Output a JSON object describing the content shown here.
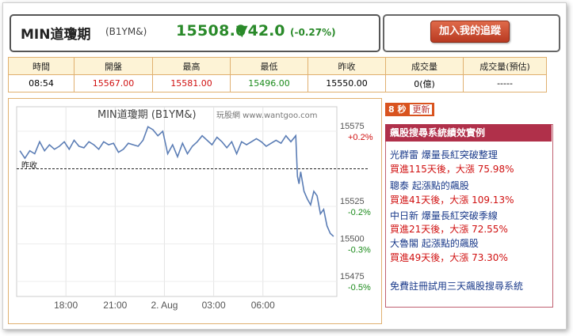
{
  "header": {
    "ticker": "MIN道瓊期",
    "code": "(B1YM&)",
    "price": "15508.0",
    "change_arrow": "▼",
    "change": "42.0",
    "change_pct": "(-0.27%)"
  },
  "track_button": "加入我的追蹤",
  "quote_table": {
    "headers": [
      "時間",
      "開盤",
      "最高",
      "最低",
      "昨收",
      "成交量",
      "成交量(預估)"
    ],
    "values": [
      "08:54",
      "15567.00",
      "15581.00",
      "15496.00",
      "15550.00",
      "0(億)",
      "-----"
    ]
  },
  "chart": {
    "title": "MIN道瓊期 (B1YM&)",
    "source": "玩股網 www.wantgoo.com",
    "prev_close_label": "昨收",
    "price_labels": [
      "15575",
      "15525",
      "15500",
      "15475"
    ],
    "pct_labels": [
      "+0.2%",
      "-0.2%",
      "-0.3%",
      "-0.5%"
    ],
    "x_labels": [
      "18:00",
      "21:00",
      "2. Aug",
      "03:00",
      "06:00"
    ]
  },
  "chart_data": {
    "type": "line",
    "title": "MIN道瓊期 (B1YM&)",
    "y_ticks": [
      15575,
      15525,
      15500,
      15475
    ],
    "y_pct_ticks": [
      "+0.2%",
      "-0.2%",
      "-0.3%",
      "-0.5%"
    ],
    "x_ticks": [
      "18:00",
      "21:00",
      "2. Aug",
      "03:00",
      "06:00"
    ],
    "prev_close": 15550,
    "ylim": [
      15465,
      15585
    ],
    "series": [
      {
        "x_hours": [
          15.2,
          15.5,
          15.8,
          16.1,
          16.4,
          16.7,
          17.0,
          17.3,
          17.6,
          17.9,
          18.2,
          18.5,
          18.8,
          19.1,
          19.4,
          19.7,
          20.0,
          20.3,
          20.6,
          20.9,
          21.2,
          21.5,
          21.8,
          22.1,
          22.4,
          22.7,
          23.0,
          23.3,
          23.6,
          23.9,
          24.2,
          24.5,
          24.8,
          25.1,
          25.4,
          25.7,
          26.0,
          26.3,
          26.6,
          26.9,
          27.2,
          27.5,
          27.8,
          28.1,
          28.4,
          28.7,
          29.0,
          29.3,
          29.6,
          29.9,
          30.2,
          30.5,
          30.8,
          31.1,
          31.4,
          31.7,
          32.0,
          32.1,
          32.2,
          32.3,
          32.5,
          32.7,
          32.9,
          33.1,
          33.3,
          33.5,
          33.7,
          33.9,
          34.1,
          34.3
        ],
        "values": [
          15562,
          15557,
          15562,
          15560,
          15568,
          15562,
          15566,
          15563,
          15565,
          15568,
          15563,
          15569,
          15565,
          15564,
          15568,
          15566,
          15563,
          15568,
          15566,
          15567,
          15561,
          15563,
          15567,
          15566,
          15565,
          15569,
          15578,
          15576,
          15572,
          15575,
          15560,
          15566,
          15558,
          15567,
          15560,
          15565,
          15568,
          15572,
          15569,
          15566,
          15571,
          15568,
          15564,
          15568,
          15560,
          15568,
          15566,
          15568,
          15570,
          15568,
          15565,
          15567,
          15569,
          15567,
          15572,
          15568,
          15572,
          15545,
          15540,
          15548,
          15535,
          15530,
          15526,
          15535,
          15532,
          15520,
          15523,
          15512,
          15507,
          15505
        ]
      }
    ]
  },
  "timer": {
    "seconds": "8 秒",
    "update_label": "更新"
  },
  "report": {
    "heading": "飆股搜尋系統績效實例",
    "items": [
      {
        "title": "光群雷 爆量長紅突破整理",
        "result": "買進115天後，大漲 75.98%"
      },
      {
        "title": "聰泰 起漲點的飆股",
        "result": "買進41天後，大漲 109.13%"
      },
      {
        "title": "中日新 爆量長紅突破季線",
        "result": "買進21天後，大漲 72.55%"
      },
      {
        "title": "大魯閣 起漲點的飆股",
        "result": "買進49天後，大漲 73.30%"
      }
    ],
    "footer": "免費註冊試用三天飆股搜尋系統"
  },
  "colors": {
    "up": "#d01010",
    "down": "#1a8a1a",
    "accent": "#b0304a",
    "line": "#5b7db5"
  }
}
